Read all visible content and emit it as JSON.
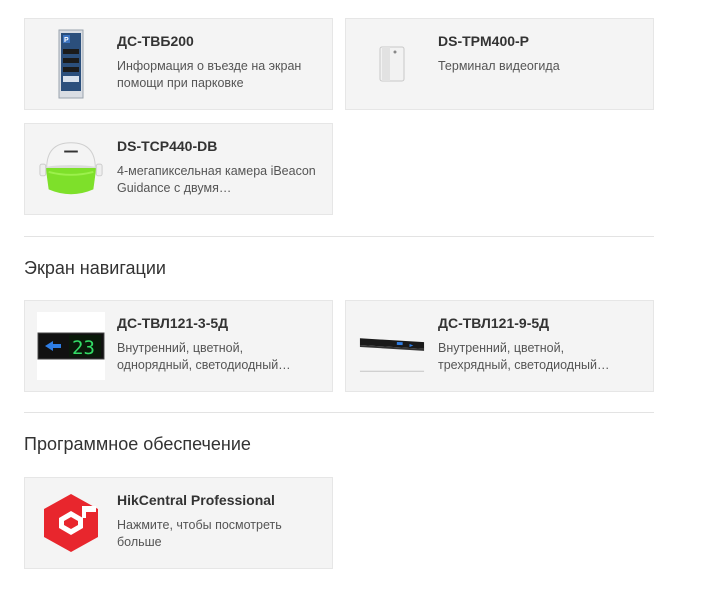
{
  "parking": {
    "cards": [
      {
        "title": "ДС-ТВБ200",
        "desc": "Информация о въезде на экран помощи при парковке",
        "image": "parking-guidance-display-image"
      },
      {
        "title": "DS-TPM400-P",
        "desc": "Терминал видеогида",
        "image": "video-guide-terminal-image"
      },
      {
        "title": "DS-TCP440-DB",
        "desc": "4-мегапиксельная камера iBeacon Guidance с двумя…",
        "image": "ibeacon-camera-image"
      }
    ]
  },
  "navigation": {
    "heading": "Экран навигации",
    "cards": [
      {
        "title": "ДС-ТВЛ121-3-5Д",
        "desc": "Внутренний, цветной, однорядный, светодиодный…",
        "image": "led-display-single-row-image",
        "display_digits": "23"
      },
      {
        "title": "ДС-ТВЛ121-9-5Д",
        "desc": "Внутренний, цветной, трехрядный, светодиодный…",
        "image": "led-display-three-row-image"
      }
    ]
  },
  "software": {
    "heading": "Программное обеспечение",
    "cards": [
      {
        "title": "HikCentral Professional",
        "desc": "Нажмите, чтобы посмотреть больше",
        "image": "hikcentral-logo"
      }
    ]
  },
  "colors": {
    "card_bg": "#f4f4f4",
    "led_green": "#33dd66",
    "camera_green": "#7ee02a",
    "hikcentral_red": "#e8262d"
  }
}
